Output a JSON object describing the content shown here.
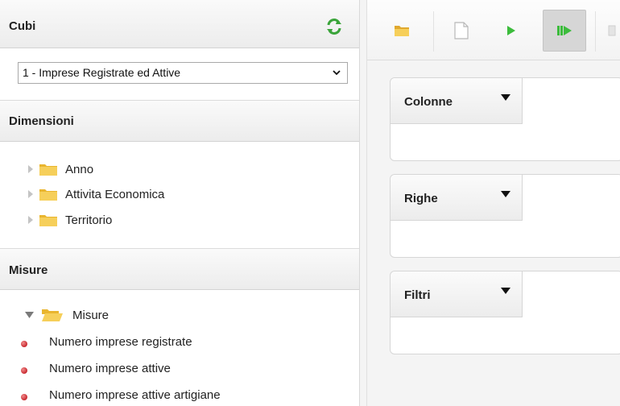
{
  "cubi": {
    "title": "Cubi",
    "selected_cube": "1 - Imprese Registrate ed Attive"
  },
  "dimensioni": {
    "title": "Dimensioni",
    "items": [
      {
        "label": "Anno"
      },
      {
        "label": "Attivita Economica"
      },
      {
        "label": "Territorio"
      }
    ]
  },
  "misure": {
    "title": "Misure",
    "folder_label": "Misure",
    "items": [
      {
        "label": "Numero imprese registrate"
      },
      {
        "label": "Numero imprese attive"
      },
      {
        "label": "Numero imprese attive artigiane"
      }
    ]
  },
  "toolbar": {
    "buttons": [
      {
        "icon": "folder-open-icon"
      },
      {
        "icon": "new-document-icon"
      },
      {
        "icon": "play-icon"
      },
      {
        "icon": "run-all-icon"
      }
    ]
  },
  "drop_zones": [
    {
      "label": "Colonne"
    },
    {
      "label": "Righe"
    },
    {
      "label": "Filtri"
    }
  ],
  "colors": {
    "refresh_green": "#3aa43a",
    "play_green": "#3cbc3c",
    "folder_yellow": "#f2c447",
    "measure_dot_red": "#c8282f"
  }
}
